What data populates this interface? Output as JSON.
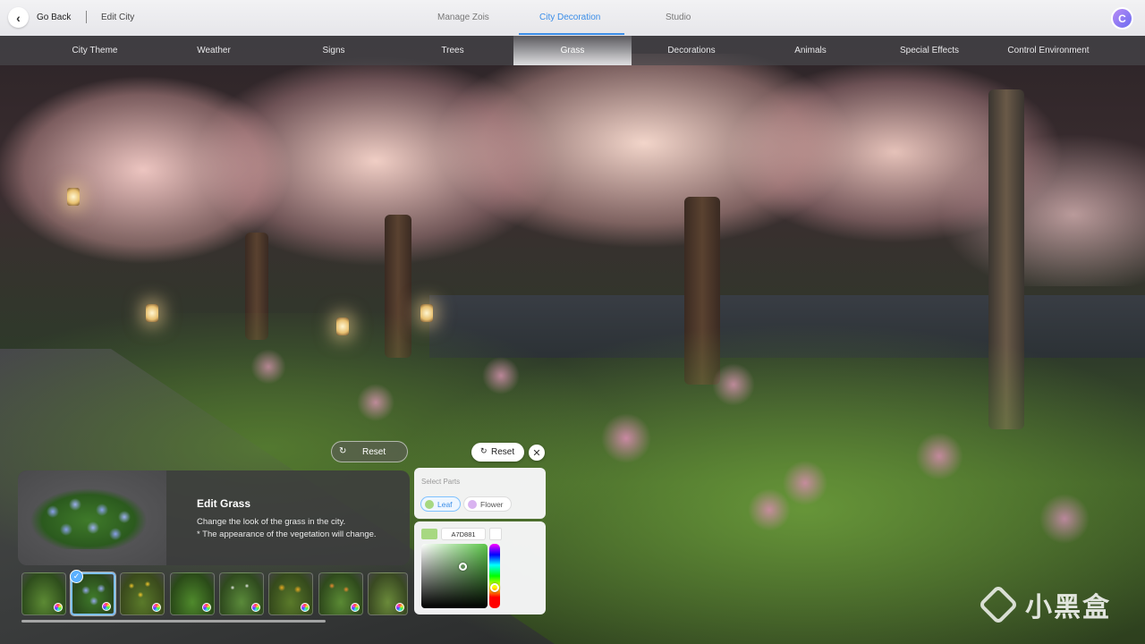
{
  "topbar": {
    "back_label": "Go Back",
    "edit_city": "Edit City",
    "tabs": [
      {
        "label": "Manage Zois",
        "active": false
      },
      {
        "label": "City Decoration",
        "active": true
      },
      {
        "label": "Studio",
        "active": false
      }
    ],
    "avatar_letter": "C",
    "accent_color": "#3b8ee8"
  },
  "categories": [
    {
      "label": "City Theme",
      "active": false
    },
    {
      "label": "Weather",
      "active": false
    },
    {
      "label": "Signs",
      "active": false
    },
    {
      "label": "Trees",
      "active": false
    },
    {
      "label": "Grass",
      "active": true
    },
    {
      "label": "Decorations",
      "active": false
    },
    {
      "label": "Animals",
      "active": false
    },
    {
      "label": "Special Effects",
      "active": false
    },
    {
      "label": "Control Environment",
      "active": false
    }
  ],
  "reset_main": {
    "label": "Reset",
    "icon": "refresh-icon"
  },
  "color_editor": {
    "reset_label": "Reset",
    "close_icon": "close-icon",
    "select_parts_label": "Select Parts",
    "parts": [
      {
        "label": "Leaf",
        "color": "#a7d881",
        "active": true
      },
      {
        "label": "Flower",
        "color": "#d9b3f0",
        "active": false
      }
    ],
    "hex_value": "A7D881",
    "swatch_color": "#A7D881"
  },
  "edit_panel": {
    "title": "Edit Grass",
    "description": "Change the look of the grass in the city.",
    "note": "* The appearance of the vegetation will change."
  },
  "grass_options": [
    {
      "name": "green-shrub",
      "selected": false
    },
    {
      "name": "hydrangea-blue",
      "selected": true
    },
    {
      "name": "yellow-flowers",
      "selected": false
    },
    {
      "name": "fern",
      "selected": false
    },
    {
      "name": "white-flower-shrub",
      "selected": false
    },
    {
      "name": "sunflower",
      "selected": false
    },
    {
      "name": "orange-flower-shrub",
      "selected": false
    },
    {
      "name": "wild-grass",
      "selected": false
    }
  ],
  "watermark": {
    "text": "小黑盒"
  }
}
